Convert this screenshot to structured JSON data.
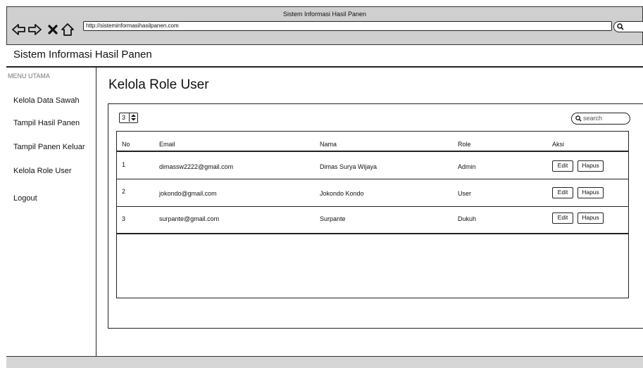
{
  "browser": {
    "window_title": "Sistem Informasi Hasil Panen",
    "url": "http://sisteminformasihasilpanen.com"
  },
  "app": {
    "title": "Sistem Informasi Hasil Panen"
  },
  "sidebar": {
    "heading": "MENU UTAMA",
    "items": [
      {
        "label": "Kelola Data Sawah"
      },
      {
        "label": "Tampil Hasil Panen"
      },
      {
        "label": "Tampil Panen Keluar"
      },
      {
        "label": "Kelola Role User"
      },
      {
        "label": "Logout"
      }
    ]
  },
  "main": {
    "page_title": "Kelola Role User",
    "page_size": "3",
    "search_placeholder": "search",
    "table": {
      "columns": [
        "No",
        "Email",
        "Nama",
        "Role",
        "Aksi"
      ],
      "rows": [
        {
          "no": "1",
          "email": "dimassw2222@gmail.com",
          "nama": "Dimas Surya Wijaya",
          "role": "Admin",
          "edit": "Edit",
          "hapus": "Hapus"
        },
        {
          "no": "2",
          "email": "jokondo@gmail.com",
          "nama": "Jokondo Kondo",
          "role": "User",
          "edit": "Edit",
          "hapus": "Hapus"
        },
        {
          "no": "3",
          "email": "surpante@gmail.com",
          "nama": "Surpante",
          "role": "Dukuh",
          "edit": "Edit",
          "hapus": "Hapus"
        }
      ]
    }
  },
  "icons": [
    "back-arrow-icon",
    "forward-arrow-icon",
    "close-icon",
    "home-icon",
    "search-icon",
    "spinner-arrows-icon"
  ],
  "colors": {
    "chrome": "#cfcfcf",
    "footer": "#d6d6d6",
    "line": "#222222"
  }
}
